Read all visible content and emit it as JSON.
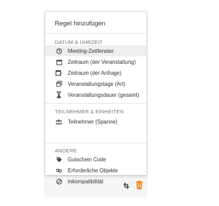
{
  "dropdown": {
    "title": "Regel hinzufügen",
    "sections": [
      {
        "heading": "DATUM & UHRZEIT",
        "items": [
          {
            "label": "Meeting-Zeitfenster",
            "icon": "clock-icon",
            "selected": true
          },
          {
            "label": "Zeitraum (der Veranstaltung)",
            "icon": "calendar-icon"
          },
          {
            "label": "Zeitraum (der Anfrage)",
            "icon": "calendar-edit-icon"
          },
          {
            "label": "Veranstaltungstage (Art)",
            "icon": "calendar-days-icon"
          },
          {
            "label": "Veranstaltungsdauer (gesamt)",
            "icon": "hourglass-icon"
          }
        ]
      },
      {
        "heading": "TEILNEHMER & EINHEITEN",
        "items": [
          {
            "label": "Teilnehmer (Spanne)",
            "icon": "people-icon"
          }
        ]
      },
      {
        "heading": "ANDERE",
        "items": [
          {
            "label": "Gutschein Code",
            "icon": "tag-icon"
          },
          {
            "label": "Erforderliche Objekte",
            "icon": "link-icon"
          },
          {
            "label": "Inkompatibilität",
            "icon": "block-icon"
          }
        ]
      }
    ]
  },
  "actions": {
    "sort_icon": "swap-vertical-icon",
    "delete_icon": "trash-icon"
  },
  "colors": {
    "accent": "#f57c00",
    "text": "#333333",
    "section_text": "#757575",
    "selected_bg": "#eeeeee"
  }
}
